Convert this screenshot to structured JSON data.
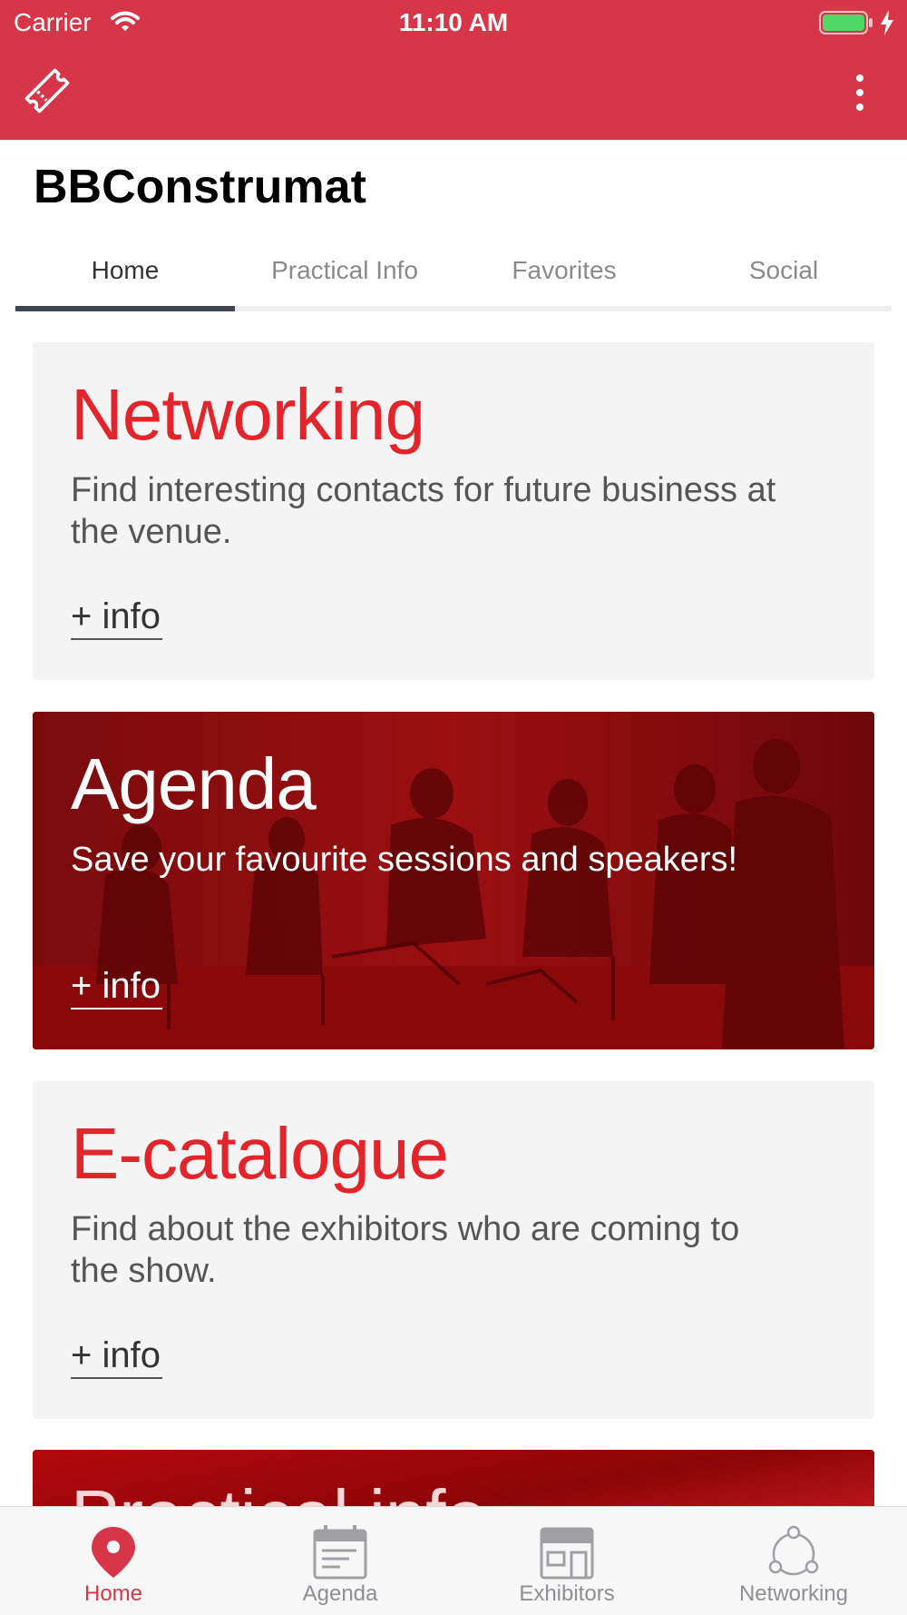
{
  "status_bar": {
    "carrier": "Carrier",
    "time": "11:10 AM"
  },
  "app": {
    "title": "BBConstrumat"
  },
  "tabs": [
    {
      "label": "Home",
      "active": true
    },
    {
      "label": "Practical Info",
      "active": false
    },
    {
      "label": "Favorites",
      "active": false
    },
    {
      "label": "Social",
      "active": false
    }
  ],
  "cards": {
    "networking": {
      "title": "Networking",
      "description": "Find interesting contacts for future business at the venue.",
      "link": "+ info"
    },
    "agenda": {
      "title": "Agenda",
      "description": "Save your favourite sessions and speakers!",
      "link": "+ info"
    },
    "ecatalogue": {
      "title": "E-catalogue",
      "description": "Find about the exhibitors who are coming to the show.",
      "link": "+ info"
    },
    "practical": {
      "title": "Practical info"
    }
  },
  "bottom_nav": [
    {
      "label": "Home",
      "icon": "map-pin-icon",
      "active": true
    },
    {
      "label": "Agenda",
      "icon": "calendar-icon",
      "active": false
    },
    {
      "label": "Exhibitors",
      "icon": "storefront-icon",
      "active": false
    },
    {
      "label": "Networking",
      "icon": "network-icon",
      "active": false
    }
  ],
  "colors": {
    "header": "#d63648",
    "accent_red": "#e3242b",
    "tab_indicator": "#3e4754",
    "card_bg": "#f4f4f4"
  }
}
